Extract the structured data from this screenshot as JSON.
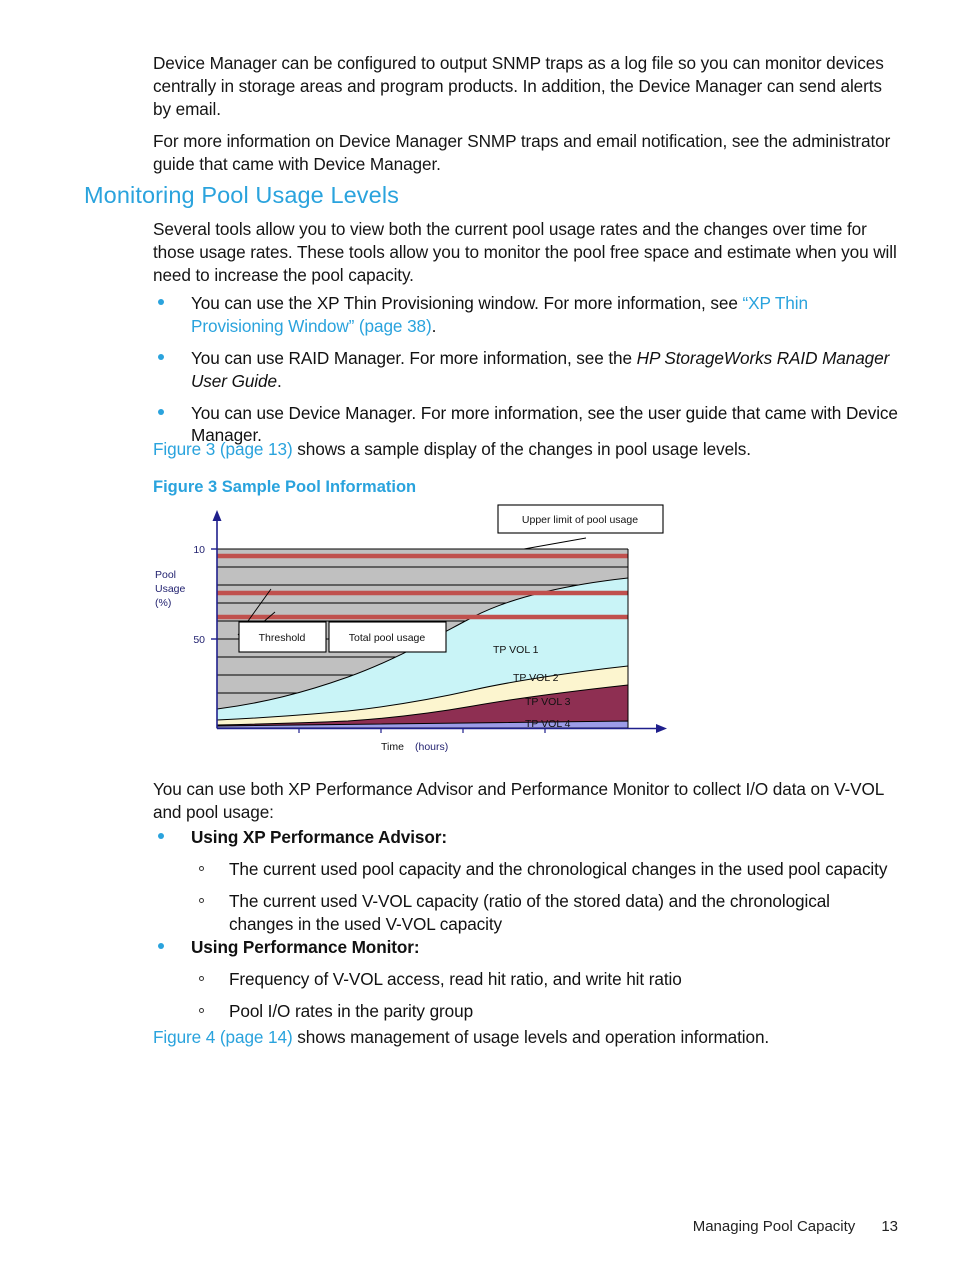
{
  "document": {
    "footer": {
      "section": "Managing Pool Capacity",
      "page_number": "13"
    }
  },
  "intro": {
    "para1": "Device Manager can be configured to output SNMP traps as a log file so you can monitor devices centrally in storage areas and program products. In addition, the Device Manager can send alerts by email.",
    "para2": "For more information on Device Manager SNMP traps and email notification, see the administrator guide that came with Device Manager."
  },
  "section": {
    "heading": "Monitoring Pool Usage Levels",
    "para1": "Several tools allow you to view both the current pool usage rates and the changes over time for those usage rates. These tools allow you to monitor the pool free space and estimate when you will need to increase the pool capacity.",
    "bullets": [
      {
        "pre": "You can use the XP Thin Provisioning window. For more information, see ",
        "link": "“XP Thin Provisioning Window” (page 38)",
        "post": "."
      },
      {
        "pre": "You can use RAID Manager. For more information, see the ",
        "italic": "HP StorageWorks RAID Manager User Guide",
        "post": "."
      },
      {
        "pre": "You can use Device Manager. For more information, see the user guide that came with Device Manager.",
        "italic": "",
        "post": ""
      }
    ],
    "figure_ref_link": "Figure 3 (page 13)",
    "figure_ref_rest": " shows a sample display of the changes in pool usage levels.",
    "figure_caption": "Figure 3 Sample Pool Information"
  },
  "after_figure": {
    "para1": "You can use both XP Performance Advisor and Performance Monitor to collect I/O data on V-VOL and pool usage:",
    "groups": [
      {
        "label": "Using XP Performance Advisor:",
        "items": [
          "The current used pool capacity and the chronological changes in the used pool capacity",
          "The current used V-VOL capacity (ratio of the stored data) and the chronological changes in the used V-VOL capacity"
        ]
      },
      {
        "label": "Using Performance Monitor:",
        "items": [
          "Frequency of V-VOL access, read hit ratio, and write hit ratio",
          "Pool I/O rates in the parity group"
        ]
      }
    ],
    "figure_ref_link": "Figure 4 (page 14)",
    "figure_ref_rest": " shows management of usage levels and operation information."
  },
  "chart_data": {
    "type": "area",
    "title": "Sample Pool Information",
    "xlabel": "Time",
    "xlabel_unit": "(hours)",
    "ylabel_lines": [
      "Pool",
      "Usage",
      "(%)"
    ],
    "ytick_labels": [
      "10",
      "50"
    ],
    "ytick_values": [
      100,
      50
    ],
    "ylim": [
      0,
      105
    ],
    "grid": true,
    "legend_position": "inline-labels",
    "colors": {
      "tp_vol_1": "#c9f4f7",
      "tp_vol_2": "#fcf5cf",
      "tp_vol_3": "#8e2f52",
      "tp_vol_4": "#9c9ce8",
      "free_space": "#c0c0c0",
      "threshold_line": "#c0504d",
      "axis": "#1f1f8c",
      "plot_border": "#000000"
    },
    "annotations": [
      {
        "name": "upper-limit-callout",
        "text": "Upper limit of pool usage"
      },
      {
        "name": "threshold-callout",
        "text": "Threshold"
      },
      {
        "name": "total-pool-usage-callout",
        "text": "Total pool usage"
      }
    ],
    "series_labels": [
      "TP VOL 1",
      "TP VOL 2",
      "TP VOL 3",
      "TP VOL 4"
    ],
    "threshold_lines_pct": [
      96,
      80,
      67
    ],
    "upper_limit_pct": 96,
    "x": [
      0,
      1,
      2,
      3,
      4,
      5,
      6,
      7,
      8,
      9,
      10
    ],
    "series": [
      {
        "name": "TP VOL 4",
        "values": [
          1.5,
          1.6,
          1.8,
          2.0,
          2.2,
          2.5,
          2.8,
          3.0,
          3.2,
          3.4,
          3.6
        ]
      },
      {
        "name": "TP VOL 3",
        "values": [
          1.0,
          1.5,
          2.2,
          3.2,
          4.5,
          6.4,
          8.6,
          10.8,
          13.0,
          15.2,
          17.0
        ]
      },
      {
        "name": "TP VOL 2",
        "values": [
          2.0,
          2.4,
          3.0,
          3.8,
          4.8,
          6.0,
          7.4,
          8.6,
          9.8,
          11.0,
          12.0
        ]
      },
      {
        "name": "TP VOL 1",
        "values": [
          7.5,
          9.0,
          11.0,
          14.0,
          18.0,
          23.0,
          28.5,
          33.5,
          38.0,
          42.0,
          45.0
        ]
      },
      {
        "name": "Free space",
        "values": [
          88.0,
          85.5,
          82.0,
          77.0,
          70.5,
          62.1,
          52.7,
          44.1,
          36.0,
          28.4,
          22.4
        ]
      }
    ]
  }
}
